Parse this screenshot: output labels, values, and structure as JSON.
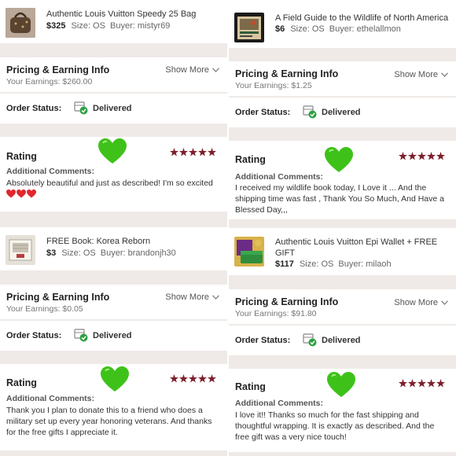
{
  "left": {
    "top": {
      "item": {
        "title": "Authentic Louis Vuitton Speedy 25 Bag",
        "price": "$325",
        "size": "Size: OS",
        "buyer": "Buyer: mistyr69"
      },
      "pricing": {
        "title": "Pricing & Earning Info",
        "earnings": "Your Earnings: $260.00",
        "show_more": "Show More"
      },
      "status": {
        "label": "Order Status:",
        "value": "Delivered"
      },
      "rating": {
        "label": "Rating",
        "comments_label": "Additional Comments:",
        "comment": "Absolutely beautiful and just as described! I'm so excited",
        "stars": 5
      }
    },
    "bottom": {
      "item": {
        "title": "FREE Book: Korea Reborn",
        "price": "$3",
        "size": "Size: OS",
        "buyer": "Buyer: brandonjh30"
      },
      "pricing": {
        "title": "Pricing & Earning Info",
        "earnings": "Your Earnings: $0.05",
        "show_more": "Show More"
      },
      "status": {
        "label": "Order Status:",
        "value": "Delivered"
      },
      "rating": {
        "label": "Rating",
        "comments_label": "Additional Comments:",
        "comment": "Thank you I plan to donate this to a friend who does a military set up every year honoring veterans. And thanks for the free gifts I appreciate it.",
        "stars": 5
      }
    }
  },
  "right": {
    "top": {
      "item": {
        "title": "A Field Guide to the Wildlife of North America",
        "price": "$6",
        "size": "Size: OS",
        "buyer": "Buyer: ethelallmon"
      },
      "pricing": {
        "title": "Pricing & Earning Info",
        "earnings": "Your Earnings: $1.25",
        "show_more": "Show More"
      },
      "status": {
        "label": "Order Status:",
        "value": "Delivered"
      },
      "rating": {
        "label": "Rating",
        "comments_label": "Additional Comments:",
        "comment": "I received my wildlife book today, I Love it ... And the shipping time was fast , Thank You So Much, And Have a Blessed Day,,,",
        "stars": 5
      }
    },
    "bottom": {
      "item": {
        "title": "Authentic Louis Vuitton Epi Wallet + FREE GIFT",
        "price": "$117",
        "size": "Size: OS",
        "buyer": "Buyer: milaoh"
      },
      "pricing": {
        "title": "Pricing & Earning Info",
        "earnings": "Your Earnings: $91.80",
        "show_more": "Show More"
      },
      "status": {
        "label": "Order Status:",
        "value": "Delivered"
      },
      "rating": {
        "label": "Rating",
        "comments_label": "Additional Comments:",
        "comment": "I love it!! Thanks so much for the fast shipping and thoughtful wrapping. It is exactly as described. And the free gift was a very nice touch!",
        "stars": 5
      }
    }
  },
  "icons": {
    "heart": "green-heart-icon",
    "star": "star-icon",
    "status": "delivered-box-icon",
    "chevron": "chevron-down-icon",
    "mini_heart": "red-heart-icon"
  },
  "colors": {
    "heart": "#3ec21a",
    "star": "#7d1f2c",
    "check": "#2ea043",
    "mini_heart": "#e0282e",
    "gap": "#efeae7"
  }
}
